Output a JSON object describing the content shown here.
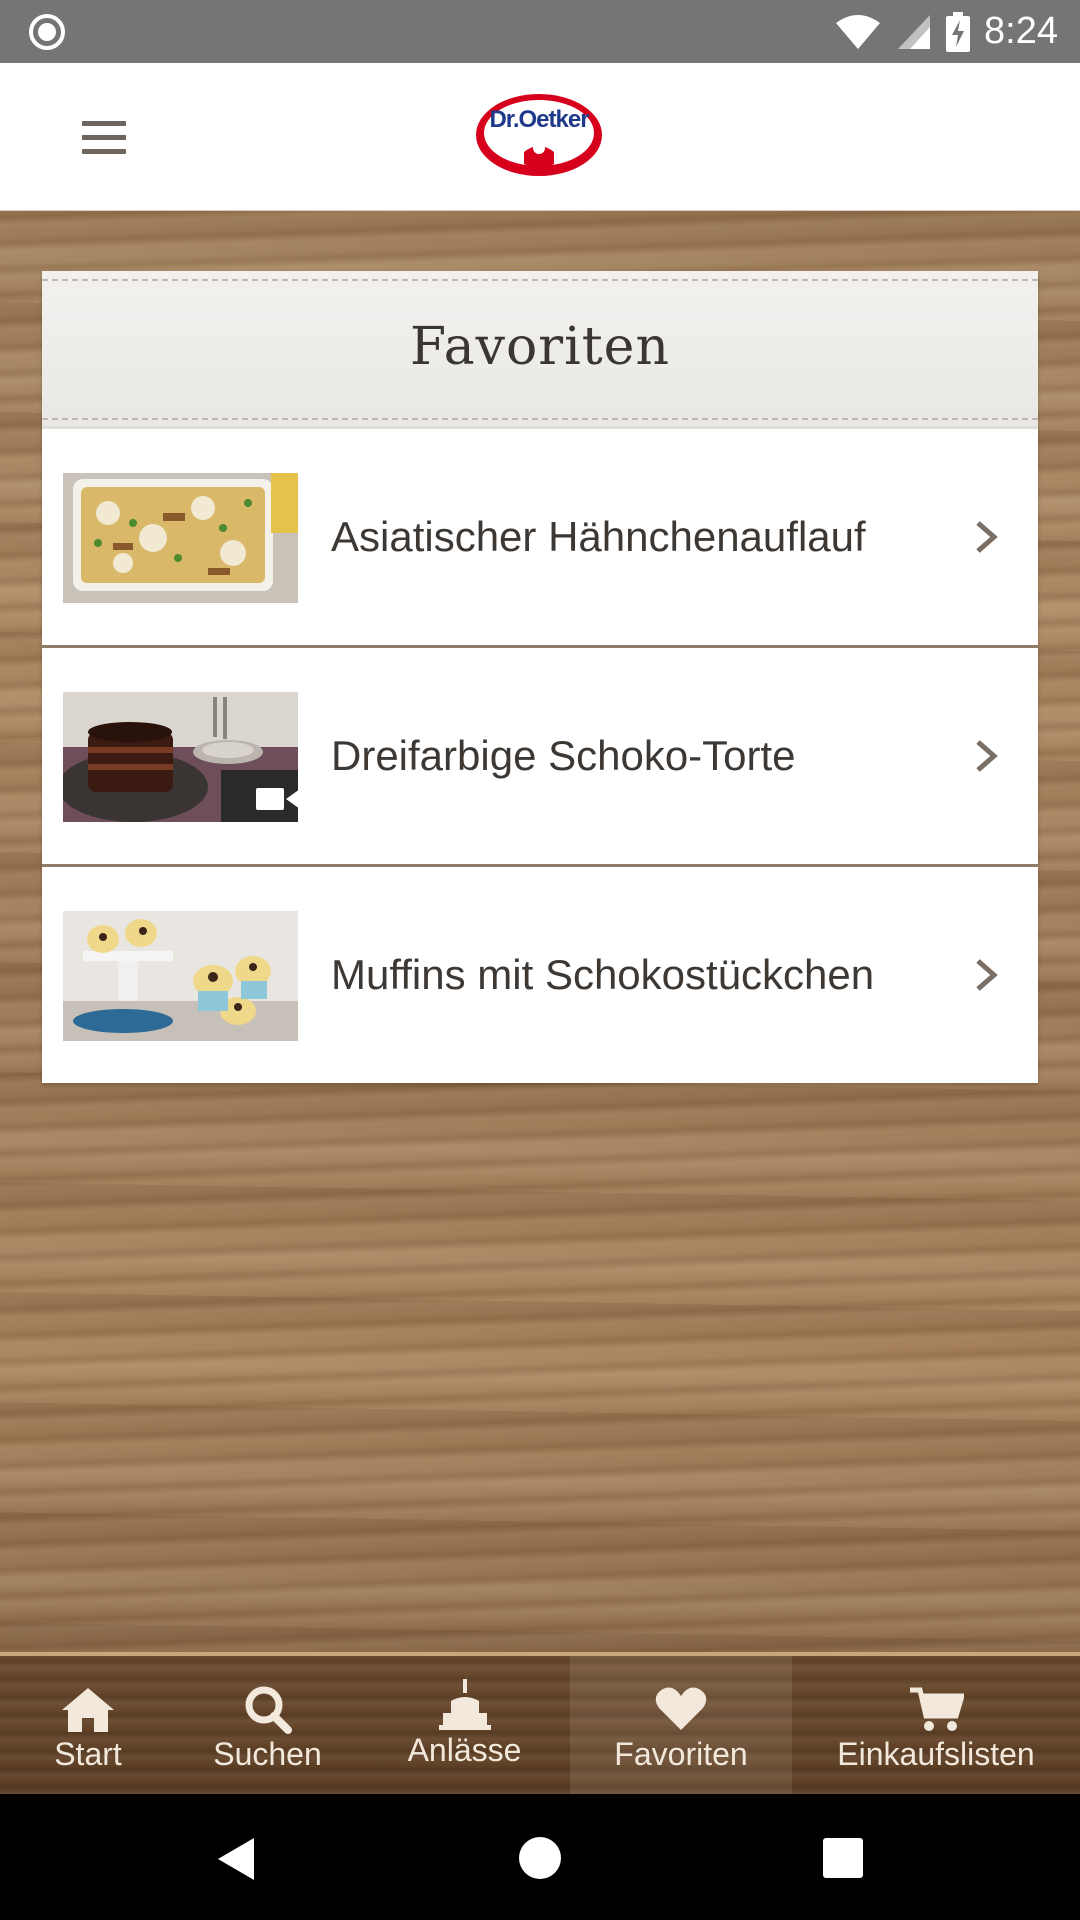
{
  "status_bar": {
    "time": "8:24",
    "icons": [
      "record-icon",
      "wifi-icon",
      "cellular-signal-icon",
      "battery-charging-icon"
    ]
  },
  "header": {
    "logo_text": "Dr.Oetker",
    "menu_icon": "hamburger-menu-icon"
  },
  "favorites": {
    "title": "Favoriten",
    "items": [
      {
        "label": "Asiatischer Hähnchenauflauf",
        "has_video": false
      },
      {
        "label": "Dreifarbige Schoko-Torte",
        "has_video": true
      },
      {
        "label": "Muffins mit Schokostückchen",
        "has_video": false
      }
    ]
  },
  "bottom_nav": {
    "items": [
      {
        "label": "Start",
        "icon": "home-icon",
        "active": false
      },
      {
        "label": "Suchen",
        "icon": "search-icon",
        "active": false
      },
      {
        "label": "Anlässe",
        "icon": "cake-icon",
        "active": false
      },
      {
        "label": "Favoriten",
        "icon": "heart-icon",
        "active": true
      },
      {
        "label": "Einkaufslisten",
        "icon": "cart-icon",
        "active": false
      }
    ]
  },
  "colors": {
    "brand_red": "#d6001c",
    "brand_blue": "#1f3a8a",
    "status_bar": "#757575",
    "nav_text": "#f2e8dc"
  }
}
